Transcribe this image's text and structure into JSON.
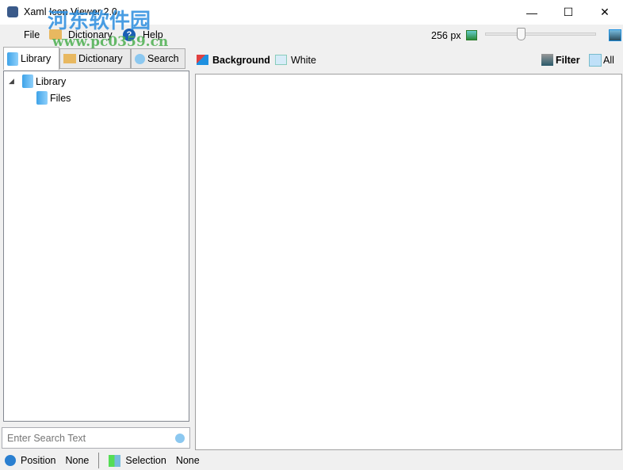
{
  "window": {
    "title": "Xaml Icon Viewer 2.0",
    "minimize": "—",
    "maximize": "☐",
    "close": "✕"
  },
  "menu": {
    "items": [
      {
        "label": "File"
      },
      {
        "label": "Dictionary"
      },
      {
        "label": "Help"
      }
    ]
  },
  "toolbar": {
    "size_label": "256 px",
    "slider_value_fraction": 0.3
  },
  "left_tabs": [
    {
      "label": "Library",
      "active": true
    },
    {
      "label": "Dictionary"
    },
    {
      "label": "Search"
    }
  ],
  "tree": [
    {
      "label": "Library",
      "expanded": true
    },
    {
      "label": "Files"
    }
  ],
  "search": {
    "placeholder": "Enter Search Text"
  },
  "right_header": {
    "background_label": "Background",
    "white_label": "White",
    "filter_label": "Filter",
    "all_label": "All"
  },
  "status": {
    "position_label": "Position",
    "position_value": "None",
    "selection_label": "Selection",
    "selection_value": "None"
  },
  "watermark": {
    "text": "河东软件园",
    "url": "www.pc0359.cn"
  },
  "colors": {
    "accent": "#1e90e0",
    "watermark_blue": "#2a8ddf",
    "watermark_green": "#4caf50"
  }
}
